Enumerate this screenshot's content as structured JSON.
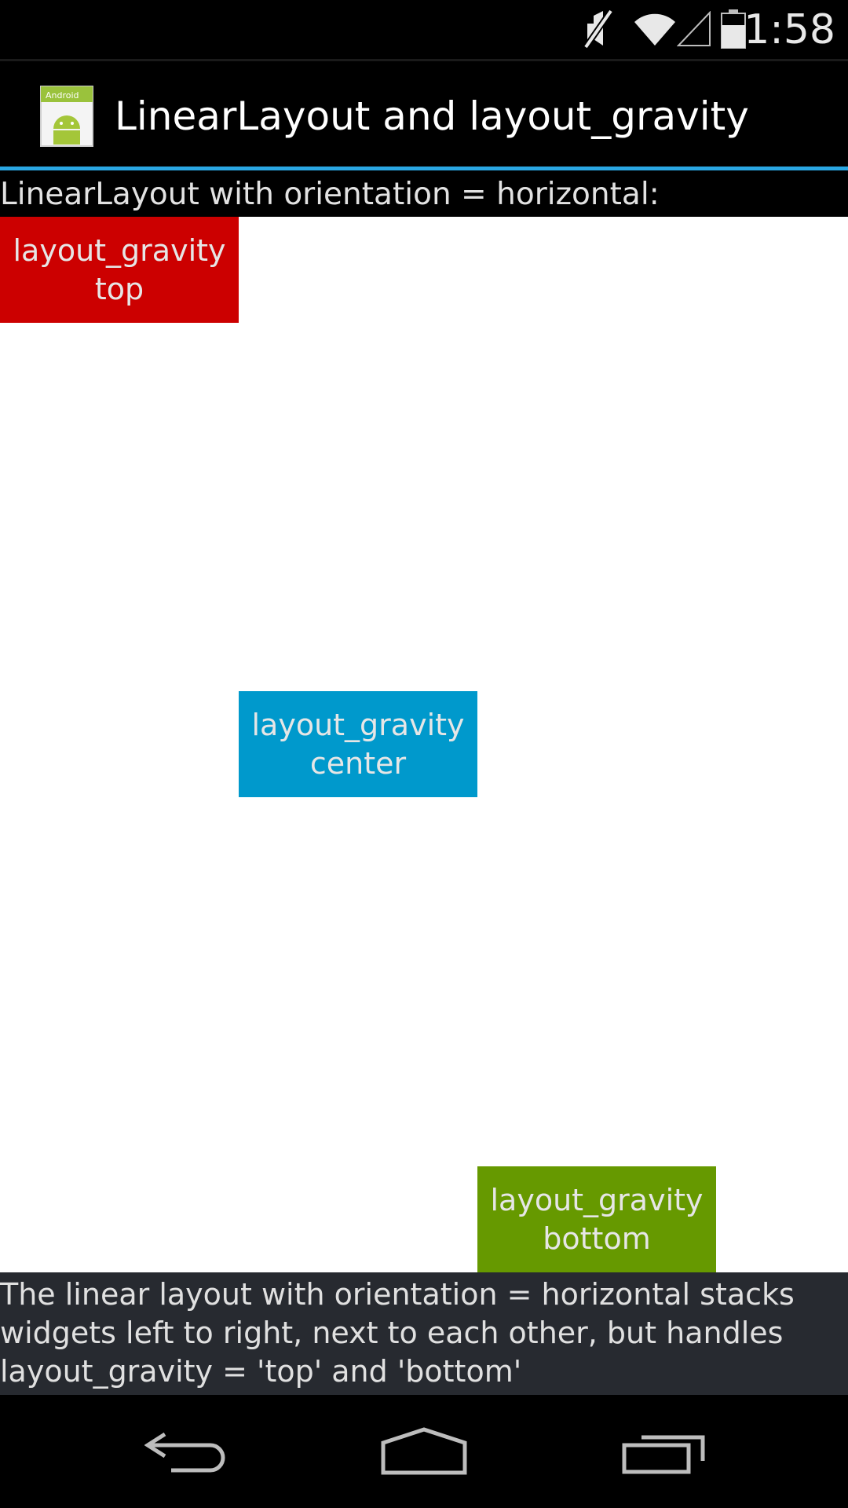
{
  "status_bar": {
    "time": "1:58",
    "icons": [
      "mute-icon",
      "wifi-icon",
      "signal-icon",
      "battery-icon"
    ]
  },
  "action_bar": {
    "title": "LinearLayout and layout_gravity",
    "icon": "android-app-icon"
  },
  "content": {
    "header": "LinearLayout with orientation = horizontal:",
    "boxes": [
      {
        "line1": "layout_gravity",
        "line2": "top",
        "color": "#cc0000"
      },
      {
        "line1": "layout_gravity",
        "line2": "center",
        "color": "#0099cc"
      },
      {
        "line1": "layout_gravity",
        "line2": "bottom",
        "color": "#669900"
      }
    ],
    "footer": "The linear layout with orientation = horizontal stacks widgets left to right, next to each other, but handles layout_gravity = 'top' and 'bottom'"
  },
  "nav_bar": {
    "icons": [
      "back-icon",
      "home-icon",
      "recent-apps-icon"
    ]
  },
  "colors": {
    "accent": "#2aa7e3",
    "footer_bg": "#272a30"
  }
}
